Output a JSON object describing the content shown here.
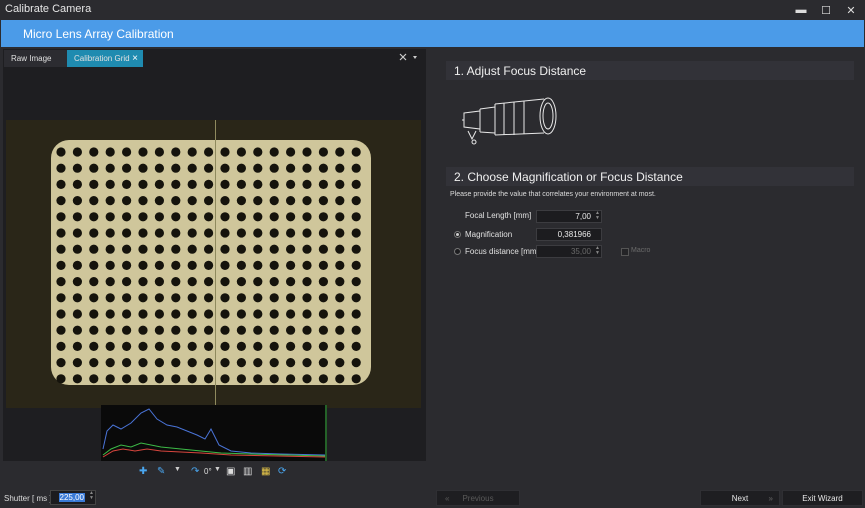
{
  "window": {
    "title": "Calibrate Camera",
    "minimize": "▬",
    "maximize": "☐",
    "close": "✕"
  },
  "banner": {
    "title": "Micro Lens Array Calibration"
  },
  "tabs": [
    {
      "label": "Raw Image"
    },
    {
      "label": "Calibration Grid",
      "close": "×"
    }
  ],
  "view_toolbar": {
    "rotation": "0°"
  },
  "shutter": {
    "label": "Shutter [ ms ]",
    "value": "225,00"
  },
  "navigation": {
    "previous": "Previous",
    "next": "Next",
    "exit": "Exit Wizard"
  },
  "step1": {
    "title": "1. Adjust Focus Distance"
  },
  "step2": {
    "title": "2. Choose Magnification or Focus Distance",
    "hint": "Please provide the value that correlates your environment at most.",
    "focal_length": {
      "label": "Focal Length [mm]",
      "value": "7,00"
    },
    "magnification": {
      "label": "Magnification",
      "value": "0,381966",
      "selected": true
    },
    "focus_distance": {
      "label": "Focus distance [mm]",
      "value": "35,00",
      "selected": false
    },
    "macro": {
      "label": "Macro",
      "checked": false
    }
  },
  "colors": {
    "accent": "#4b9be8",
    "tab_active": "#1f8bb0",
    "background": "#2b2b2f"
  }
}
